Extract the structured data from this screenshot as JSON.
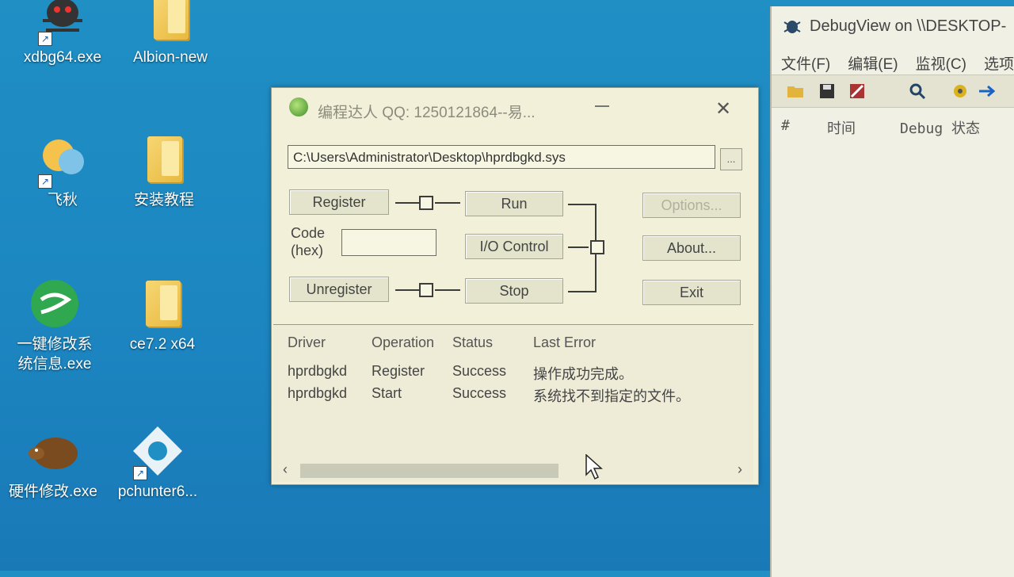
{
  "desktop": {
    "icons": [
      {
        "label": "xdbg64.exe"
      },
      {
        "label": "Albion-new"
      },
      {
        "label": "飞秋"
      },
      {
        "label": "安装教程"
      },
      {
        "label": "一键修改系\n统信息.exe"
      },
      {
        "label": "ce7.2 x64"
      },
      {
        "label": "硬件修改.exe"
      },
      {
        "label": "pchunter6..."
      }
    ]
  },
  "loader": {
    "title": "编程达人 QQ: 1250121864--易...",
    "path_value": "C:\\Users\\Administrator\\Desktop\\hprdbgkd.sys",
    "browse_label": "...",
    "buttons": {
      "register": "Register",
      "run": "Run",
      "options": "Options...",
      "io_control": "I/O Control",
      "about": "About...",
      "unregister": "Unregister",
      "stop": "Stop",
      "exit": "Exit"
    },
    "code_label": "Code\n(hex)",
    "code_value": "",
    "list": {
      "columns": [
        "Driver",
        "Operation",
        "Status",
        "Last Error"
      ],
      "rows": [
        {
          "driver": "hprdbgkd",
          "operation": "Register",
          "status": "Success",
          "last_error": "操作成功完成。"
        },
        {
          "driver": "hprdbgkd",
          "operation": "Start",
          "status": "Success",
          "last_error": "系统找不到指定的文件。"
        }
      ]
    }
  },
  "debugview": {
    "title": "DebugView on \\\\DESKTOP-",
    "menu": [
      "文件(F)",
      "编辑(E)",
      "监视(C)",
      "选项"
    ],
    "columns": [
      "#",
      "时间",
      "Debug 状态"
    ]
  }
}
